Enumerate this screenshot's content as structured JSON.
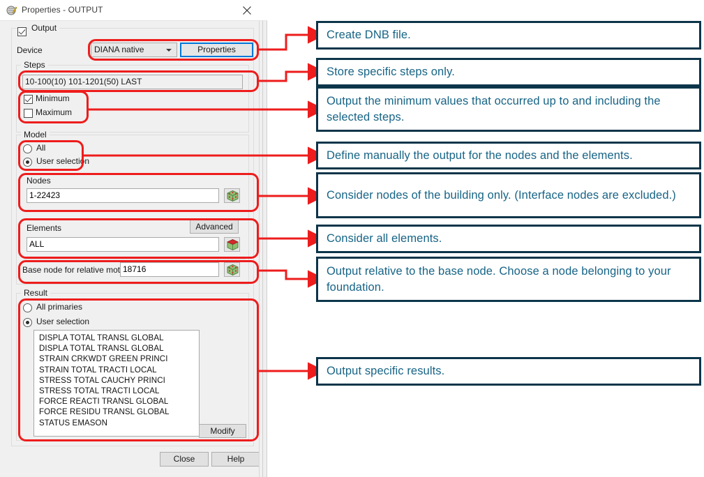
{
  "window": {
    "title": "Properties - OUTPUT",
    "icon": "diana-app-icon",
    "close_label": "close-icon"
  },
  "output_group": {
    "checkbox_label": "Output",
    "checked": true
  },
  "device": {
    "label": "Device",
    "selected": "DIANA native",
    "options": [
      "DIANA native"
    ],
    "properties_button": "Properties"
  },
  "steps": {
    "group_label": "Steps",
    "value": "10-100(10) 101-1201(50) LAST",
    "minimum_label": "Minimum",
    "minimum_checked": true,
    "maximum_label": "Maximum",
    "maximum_checked": false
  },
  "model": {
    "group_label": "Model",
    "all_label": "All",
    "user_selection_label": "User selection",
    "selected": "User selection",
    "nodes_label": "Nodes",
    "nodes_value": "1-22423",
    "elements_label": "Elements",
    "elements_value": "ALL",
    "advanced_button": "Advanced",
    "base_node_label": "Base node for relative motion",
    "base_node_value": "18716",
    "picker_icon": "mesh-picker-icon"
  },
  "result": {
    "group_label": "Result",
    "all_primaries_label": "All primaries",
    "user_selection_label": "User selection",
    "selected": "User selection",
    "items": [
      "DISPLA TOTAL TRANSL GLOBAL",
      "DISPLA TOTAL TRANSL GLOBAL",
      "STRAIN CRKWDT GREEN PRINCI",
      "STRAIN TOTAL TRACTI LOCAL",
      "STRESS TOTAL CAUCHY PRINCI",
      "STRESS TOTAL TRACTI LOCAL",
      "FORCE REACTI TRANSL GLOBAL",
      "FORCE RESIDU TRANSL GLOBAL",
      "STATUS EMASON"
    ],
    "modify_button": "Modify"
  },
  "footer": {
    "close_button": "Close",
    "help_button": "Help"
  },
  "callouts": [
    {
      "id": "create-dnb-file",
      "text": "Create DNB file."
    },
    {
      "id": "store-specific-steps",
      "text": "Store specific steps only."
    },
    {
      "id": "output-minimum-values",
      "text": "Output the minimum values that occurred up to and including the selected steps."
    },
    {
      "id": "define-manually-output",
      "text": "Define manually the output for the nodes and the elements."
    },
    {
      "id": "consider-building-nodes",
      "text": "Consider nodes of the building only. (Interface nodes are excluded.)"
    },
    {
      "id": "consider-all-elements",
      "text": "Consider all elements."
    },
    {
      "id": "output-relative-base-node",
      "text": "Output relative to the base node. Choose a node belonging to your foundation."
    },
    {
      "id": "output-specific-results",
      "text": "Output specific results."
    }
  ],
  "colors": {
    "highlight": "#ee1c1c",
    "callout_border": "#0c3549",
    "callout_text": "#176486",
    "dialog_bg": "#f0f0f0",
    "focus_blue": "#0078d7"
  }
}
